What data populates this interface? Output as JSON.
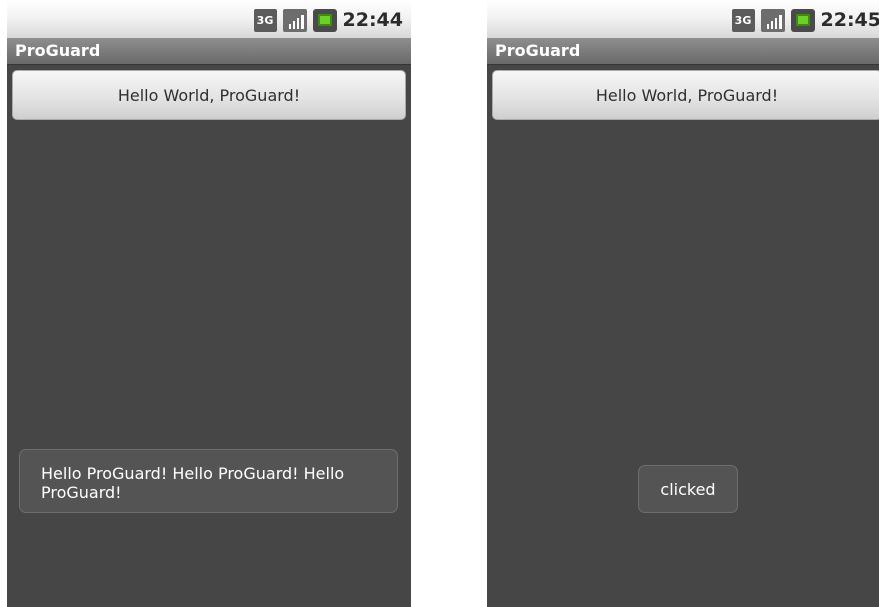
{
  "screens": [
    {
      "status": {
        "network": "3G",
        "time": "22:44"
      },
      "app_title": "ProGuard",
      "button_label": "Hello World, ProGuard!",
      "toast_text": "Hello ProGuard! Hello ProGuard! Hello ProGuard!"
    },
    {
      "status": {
        "network": "3G",
        "time": "22:45"
      },
      "app_title": "ProGuard",
      "button_label": "Hello World, ProGuard!",
      "toast_text": "clicked"
    }
  ],
  "icons": {
    "network": "3g-network-icon",
    "signal": "signal-strength-icon",
    "battery": "battery-icon"
  },
  "colors": {
    "screen_background": "#464646",
    "battery_accent": "#6bd12a"
  }
}
